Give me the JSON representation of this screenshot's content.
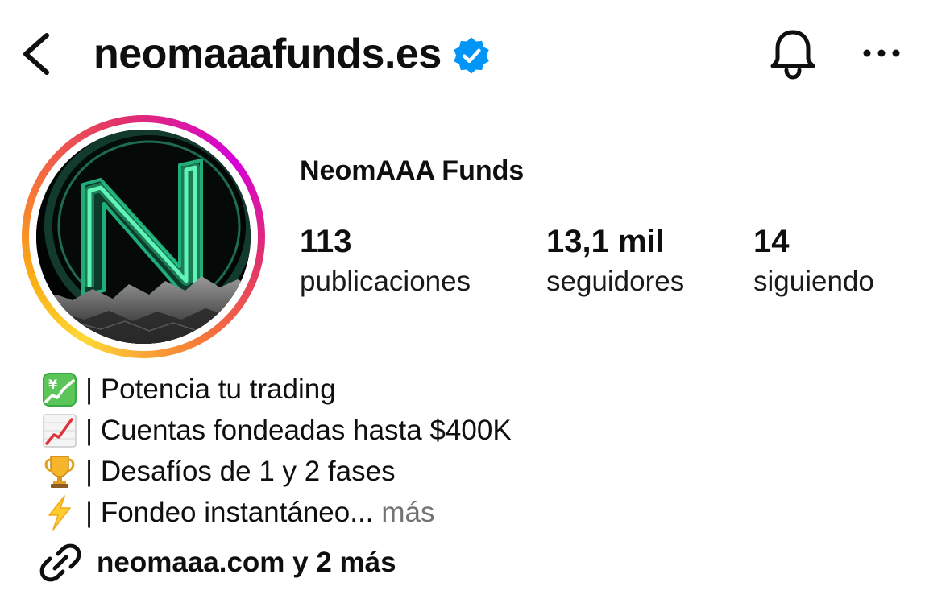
{
  "header": {
    "username": "neomaaafunds.es",
    "verified": true
  },
  "profile": {
    "display_name": "NeomAAA Funds",
    "stats": [
      {
        "value": "113",
        "label": "publicaciones"
      },
      {
        "value": "13,1 mil",
        "label": "seguidores"
      },
      {
        "value": "14",
        "label": "siguiendo"
      }
    ]
  },
  "bio": {
    "lines": [
      {
        "icon": "chart-yen-icon",
        "text": "| Potencia tu trading"
      },
      {
        "icon": "chart-increasing-icon",
        "text": "| Cuentas fondeadas hasta $400K"
      },
      {
        "icon": "trophy-icon",
        "text": "| Desafíos de 1 y 2 fases"
      },
      {
        "icon": "lightning-icon",
        "text": "| Fondeo instantáneo..."
      }
    ],
    "more_label": "más"
  },
  "link": {
    "text": "neomaaa.com y 2 más",
    "icon": "link-icon"
  },
  "colors": {
    "verified_blue": "#0095f6",
    "muted_text": "#737373",
    "ring_pink": "#d400d7",
    "ring_orange": "#f77737",
    "ring_yellow": "#fdd835",
    "neon_green": "#3cf0a0"
  }
}
